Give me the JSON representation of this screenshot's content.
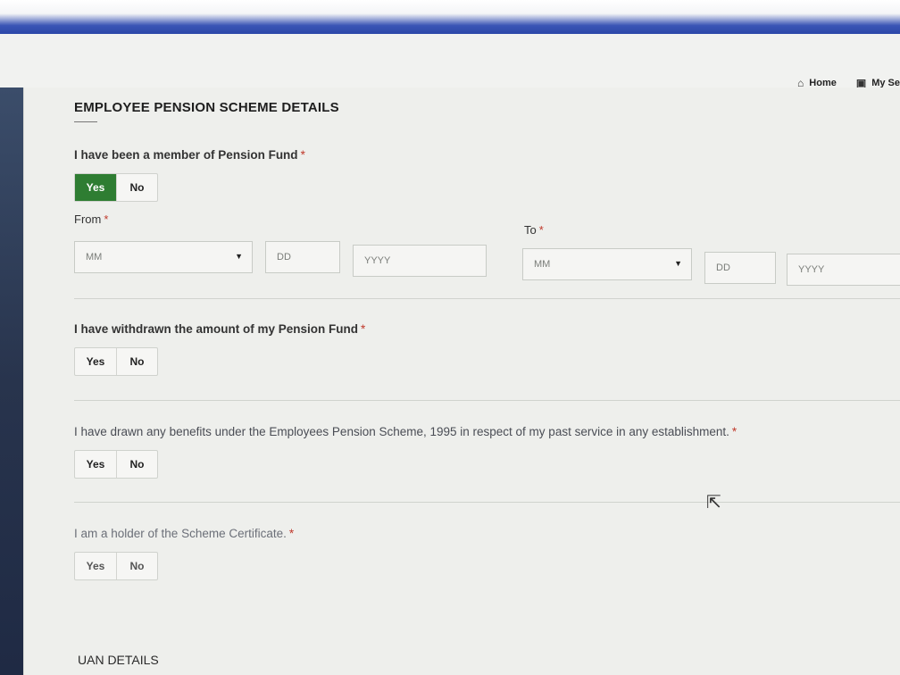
{
  "header": {
    "nav": [
      {
        "label": "Home",
        "icon": "home-icon"
      },
      {
        "label": "My Se",
        "icon": "briefcase-icon"
      }
    ]
  },
  "section": {
    "title": "EMPLOYEE PENSION SCHEME DETAILS"
  },
  "q1": {
    "label": "I have been a member of Pension Fund",
    "required": "*",
    "yes": "Yes",
    "no": "No",
    "selected": "Yes"
  },
  "from": {
    "label": "From",
    "required": "*",
    "month_placeholder": "MM",
    "day_placeholder": "DD",
    "year_placeholder": "YYYY"
  },
  "to": {
    "label": "To",
    "required": "*",
    "month_placeholder": "MM",
    "day_placeholder": "DD",
    "year_placeholder": "YYYY"
  },
  "q2": {
    "label": "I have withdrawn the amount of my Pension Fund",
    "required": "*",
    "yes": "Yes",
    "no": "No"
  },
  "q3": {
    "label": "I have drawn any benefits under the Employees Pension Scheme, 1995 in respect of my past service in any establishment.",
    "required": "*",
    "yes": "Yes",
    "no": "No"
  },
  "q4": {
    "label": "I am a holder of the Scheme Certificate.",
    "required": "*",
    "yes": "Yes",
    "no": "No"
  },
  "uan": {
    "title": "UAN DETAILS"
  },
  "colors": {
    "active_toggle": "#2e7d32",
    "required_star": "#c0392b",
    "top_bar": "#2b47a8"
  }
}
